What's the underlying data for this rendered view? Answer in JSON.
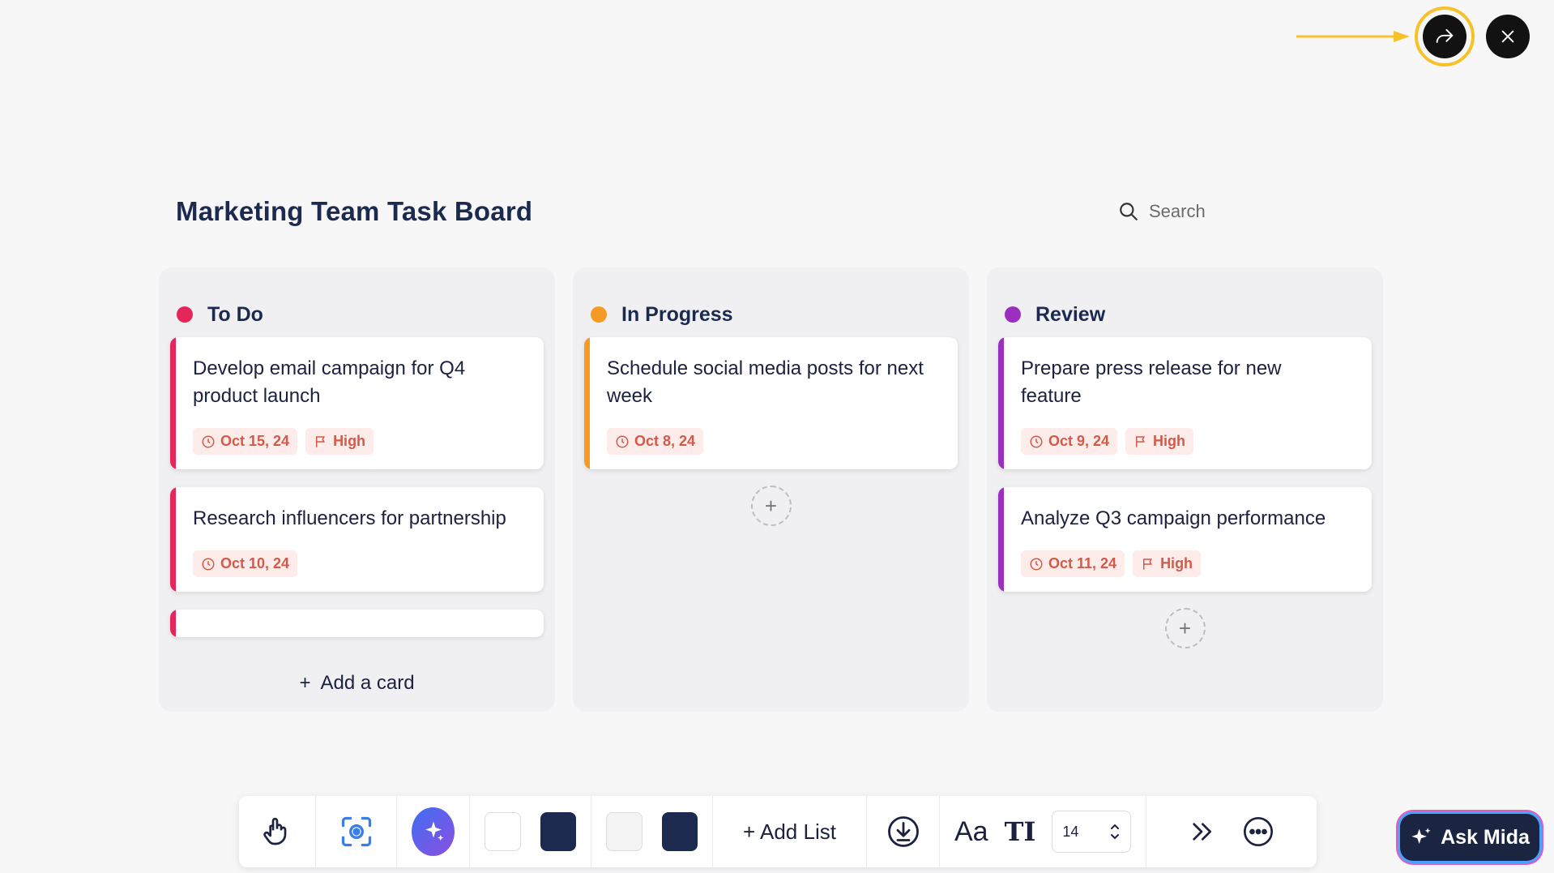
{
  "board": {
    "title": "Marketing Team Task Board",
    "search_placeholder": "Search"
  },
  "columns": [
    {
      "title": "To Do",
      "color": "#e5265a",
      "cards": [
        {
          "title": "Develop email campaign for Q4 product launch",
          "date": "Oct 15, 24",
          "priority": "High"
        },
        {
          "title": "Research influencers for partnership",
          "date": "Oct 10, 24",
          "priority": ""
        }
      ],
      "add_card_label": "Add a card"
    },
    {
      "title": "In Progress",
      "color": "#f59a25",
      "cards": [
        {
          "title": "Schedule social media posts for next week",
          "date": "Oct 8, 24",
          "priority": ""
        }
      ]
    },
    {
      "title": "Review",
      "color": "#9b30c0",
      "cards": [
        {
          "title": "Prepare press release for new feature",
          "date": "Oct 9, 24",
          "priority": "High"
        },
        {
          "title": "Analyze Q3 campaign performance",
          "date": "Oct 11, 24",
          "priority": "High"
        }
      ]
    }
  ],
  "toolbar": {
    "add_list_label": "+ Add List",
    "font_label": "Aa",
    "text_size_label": "TI",
    "font_size": "14",
    "swatches": [
      "#ffffff",
      "#1b2a4e",
      "#f3f3f4",
      "#1b2a4e"
    ]
  },
  "assistant": {
    "label": "Ask Mida"
  },
  "colors": {
    "highlight": "#f7c12a",
    "tag_bg": "#fdecea",
    "tag_text": "#d25a4a"
  }
}
